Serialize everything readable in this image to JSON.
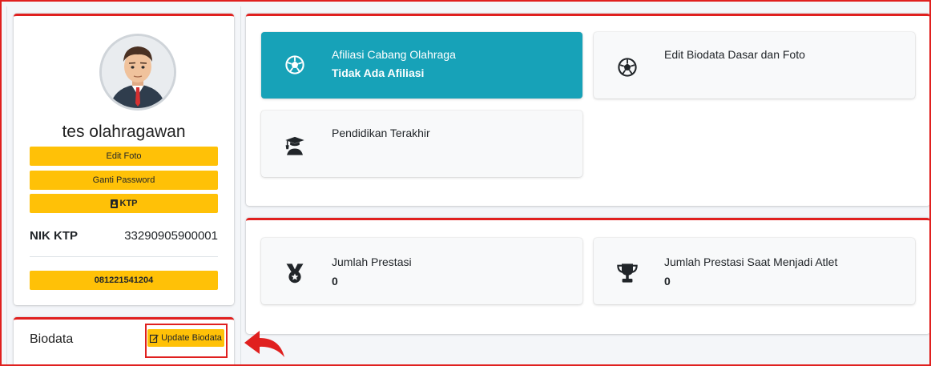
{
  "profile": {
    "name": "tes olahragawan",
    "edit_photo_label": "Edit Foto",
    "change_password_label": "Ganti Password",
    "ktp_label": "KTP",
    "nik_label": "NIK KTP",
    "nik_value": "33290905900001",
    "phone": "081221541204"
  },
  "biodata": {
    "title": "Biodata",
    "update_label": "Update Biodata"
  },
  "menu": [
    {
      "title": "Afiliasi Cabang Olahraga",
      "subtitle": "Tidak Ada Afiliasi",
      "icon": "soccer-ball-icon"
    },
    {
      "title": "Edit Biodata Dasar dan Foto",
      "icon": "soccer-ball-icon"
    },
    {
      "title": "Pendidikan Terakhir",
      "icon": "graduate-icon"
    }
  ],
  "stats": [
    {
      "title": "Jumlah Prestasi",
      "value": "0",
      "icon": "medal-icon"
    },
    {
      "title": "Jumlah Prestasi Saat Menjadi Atlet",
      "value": "0",
      "icon": "trophy-icon"
    }
  ],
  "colors": {
    "accent_red": "#e0201f",
    "button_yellow": "#ffc107",
    "teal": "#17a2b8"
  }
}
